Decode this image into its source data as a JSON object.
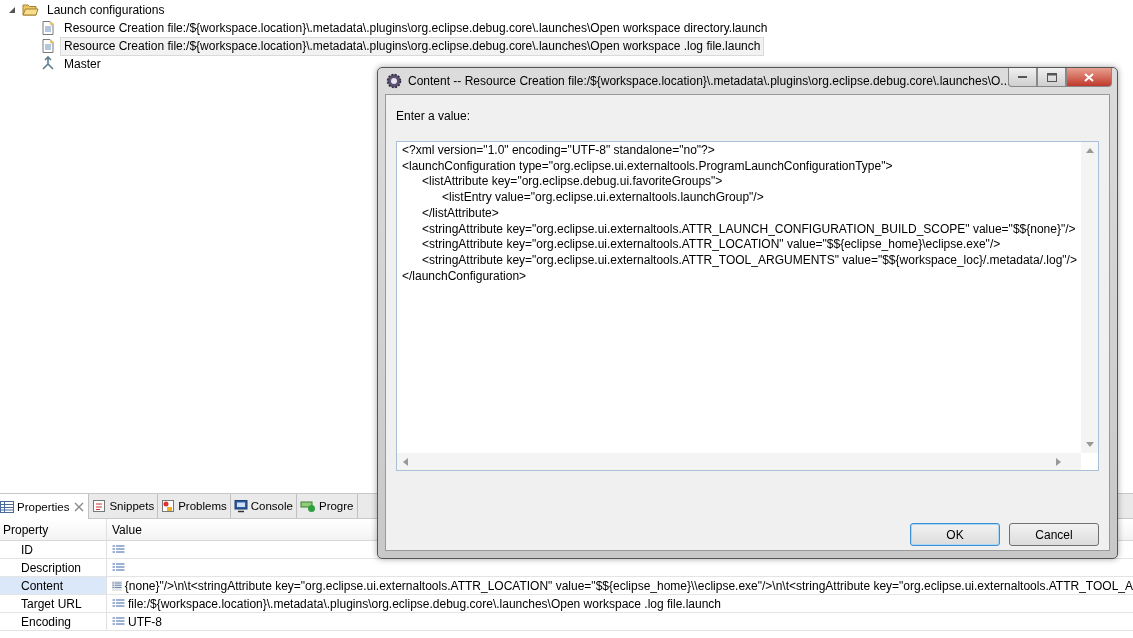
{
  "tree": {
    "label": "Launch configurations",
    "expanded": true,
    "children": [
      {
        "label": "Resource Creation file:/${workspace.location}\\.metadata\\.plugins\\org.eclipse.debug.core\\.launches\\Open workspace directory.launch",
        "kind": "config",
        "selected": false
      },
      {
        "label": "Resource Creation file:/${workspace.location}\\.metadata\\.plugins\\org.eclipse.debug.core\\.launches\\Open workspace .log file.launch",
        "kind": "config",
        "selected": true
      },
      {
        "label": "Master",
        "kind": "master",
        "selected": false
      }
    ]
  },
  "panel": {
    "tabs": [
      {
        "label": "Properties",
        "kind": "properties",
        "selected": true
      },
      {
        "label": "Snippets",
        "kind": "snippets",
        "selected": false
      },
      {
        "label": "Problems",
        "kind": "problems",
        "selected": false
      },
      {
        "label": "Console",
        "kind": "console",
        "selected": false
      },
      {
        "label": "Progre",
        "kind": "progress",
        "selected": false
      }
    ],
    "columns": [
      "Property",
      "Value"
    ],
    "rows": [
      {
        "property": "ID",
        "selected": false
      },
      {
        "property": "Description",
        "selected": false
      },
      {
        "property": "Content",
        "value": "{none}\"/>\\n\\t<stringAttribute key=\"org.eclipse.ui.externaltools.ATTR_LOCATION\" value=\"$${eclipse_home}\\\\eclipse.exe\"/>\\n\\t<stringAttribute key=\"org.eclipse.ui.externaltools.ATTR_TOOL_A",
        "selected": true
      },
      {
        "property": "Target URL",
        "value": "file:/${workspace.location}\\.metadata\\.plugins\\org.eclipse.debug.core\\.launches\\Open workspace .log file.launch",
        "selected": false
      },
      {
        "property": "Encoding",
        "value": "UTF-8",
        "selected": false
      }
    ]
  },
  "dialog": {
    "title": "Content -- Resource Creation file:/${workspace.location}\\.metadata\\.plugins\\org.eclipse.debug.core\\.launches\\O...",
    "prompt": "Enter a value:",
    "value": "<?xml version=\"1.0\" encoding=\"UTF-8\" standalone=\"no\"?>\n<launchConfiguration type=\"org.eclipse.ui.externaltools.ProgramLaunchConfigurationType\">\n\t<listAttribute key=\"org.eclipse.debug.ui.favoriteGroups\">\n\t\t<listEntry value=\"org.eclipse.ui.externaltools.launchGroup\"/>\n\t</listAttribute>\n\t<stringAttribute key=\"org.eclipse.ui.externaltools.ATTR_LAUNCH_CONFIGURATION_BUILD_SCOPE\" value=\"$${none}\"/>\n\t<stringAttribute key=\"org.eclipse.ui.externaltools.ATTR_LOCATION\" value=\"$${eclipse_home}\\eclipse.exe\"/>\n\t<stringAttribute key=\"org.eclipse.ui.externaltools.ATTR_TOOL_ARGUMENTS\" value=\"$${workspace_loc}/.metadata/.log\"/>\n</launchConfiguration>",
    "buttons": [
      {
        "label": "OK",
        "default": true
      },
      {
        "label": "Cancel",
        "default": false
      }
    ]
  }
}
